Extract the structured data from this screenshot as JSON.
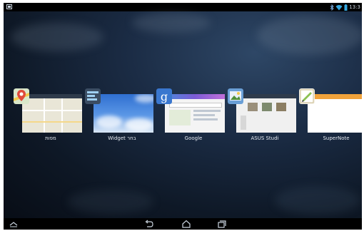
{
  "status_bar": {
    "time": "13:3",
    "icons": [
      "screenshot-icon",
      "bluetooth-icon",
      "wifi-icon",
      "battery-icon"
    ]
  },
  "recent_apps": [
    {
      "label": "מפות",
      "icon": "maps-icon"
    },
    {
      "label": "Widget בחר",
      "icon": "widget-picker-icon"
    },
    {
      "label": "Google",
      "icon": "google-search-icon"
    },
    {
      "label": "ASUS Studi",
      "icon": "asus-studio-icon"
    },
    {
      "label": "SuperNote",
      "icon": "supernote-icon"
    }
  ],
  "nav_bar": {
    "buttons": [
      "recents-up-icon",
      "back-icon",
      "home-icon",
      "recent-apps-icon"
    ]
  }
}
